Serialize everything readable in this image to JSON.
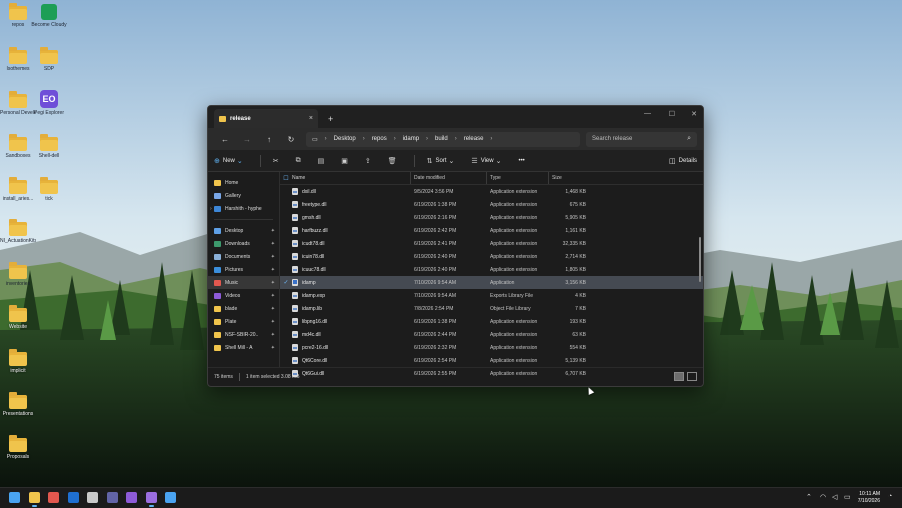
{
  "desktop": {
    "icons": [
      {
        "label": "repos"
      },
      {
        "label": "Become Cloudy"
      },
      {
        "label": "Isothemes"
      },
      {
        "label": "SDP"
      },
      {
        "label": "Personal Development..."
      },
      {
        "label": "Pegi Explorer"
      },
      {
        "label": "Sandboxes"
      },
      {
        "label": "Shell-dell"
      },
      {
        "label": "install_aries..."
      },
      {
        "label": "tick"
      },
      {
        "label": "NI_ActuationKits"
      },
      {
        "label": "inventories"
      },
      {
        "label": "Website"
      },
      {
        "label": "implicit"
      },
      {
        "label": "Presentations"
      },
      {
        "label": "Proposals"
      }
    ]
  },
  "window": {
    "tab_title": "release",
    "tab_close": "×",
    "new_tab": "+",
    "minimize": "—",
    "maximize": "☐",
    "close": "✕",
    "breadcrumb": [
      "Desktop",
      "repos",
      "idamp",
      "build",
      "release"
    ],
    "search_placeholder": "Search release",
    "toolbar": {
      "new": "New",
      "sort": "Sort",
      "view": "View",
      "more": "•••",
      "details": "Details"
    },
    "sidebar": [
      {
        "label": "Home",
        "color": "#f0c44c",
        "pinned": false
      },
      {
        "label": "Gallery",
        "color": "#7aa7e8",
        "pinned": false
      },
      {
        "label": "Harshith - hyphe",
        "color": "#3d86d6",
        "pinned": false
      },
      {
        "label": "Desktop",
        "color": "#5fa0e6",
        "pinned": true
      },
      {
        "label": "Downloads",
        "color": "#3d9a6d",
        "pinned": true
      },
      {
        "label": "Documents",
        "color": "#8ab0d8",
        "pinned": true
      },
      {
        "label": "Pictures",
        "color": "#3b8fdc",
        "pinned": true
      },
      {
        "label": "Music",
        "color": "#e2584f",
        "pinned": true
      },
      {
        "label": "Videos",
        "color": "#8e5bd8",
        "pinned": true
      },
      {
        "label": "blade",
        "color": "#f0c44c",
        "pinned": true
      },
      {
        "label": "Plate",
        "color": "#f0c44c",
        "pinned": true
      },
      {
        "label": "NSF-SBIR-20..",
        "color": "#f0c44c",
        "pinned": true
      },
      {
        "label": "Shell Mill - A",
        "color": "#f0c44c",
        "pinned": true
      }
    ],
    "columns": {
      "name": "Name",
      "date": "Date modified",
      "type": "Type",
      "size": "Size"
    },
    "files": [
      {
        "name": "dxil.dll",
        "date": "9/5/2024 3:56 PM",
        "type": "Application extension",
        "size": "1,468 KB",
        "selected": false,
        "app": false
      },
      {
        "name": "freetype.dll",
        "date": "6/19/2026 1:38 PM",
        "type": "Application extension",
        "size": "675 KB",
        "selected": false,
        "app": false
      },
      {
        "name": "gmsh.dll",
        "date": "6/19/2026 2:16 PM",
        "type": "Application extension",
        "size": "5,905 KB",
        "selected": false,
        "app": false
      },
      {
        "name": "harfbuzz.dll",
        "date": "6/19/2026 2:42 PM",
        "type": "Application extension",
        "size": "1,161 KB",
        "selected": false,
        "app": false
      },
      {
        "name": "icudt78.dll",
        "date": "6/19/2026 2:41 PM",
        "type": "Application extension",
        "size": "32,335 KB",
        "selected": false,
        "app": false
      },
      {
        "name": "icuin78.dll",
        "date": "6/19/2026 2:40 PM",
        "type": "Application extension",
        "size": "2,714 KB",
        "selected": false,
        "app": false
      },
      {
        "name": "icuuc78.dll",
        "date": "6/19/2026 2:40 PM",
        "type": "Application extension",
        "size": "1,805 KB",
        "selected": false,
        "app": false
      },
      {
        "name": "idamp",
        "date": "7/10/2026 9:54 AM",
        "type": "Application",
        "size": "3,156 KB",
        "selected": true,
        "app": true
      },
      {
        "name": "idamp.exp",
        "date": "7/10/2026 9:54 AM",
        "type": "Exports Library File",
        "size": "4 KB",
        "selected": false,
        "app": false
      },
      {
        "name": "idamp.lib",
        "date": "7/8/2026 2:54 PM",
        "type": "Object File Library",
        "size": "7 KB",
        "selected": false,
        "app": false
      },
      {
        "name": "libpng16.dll",
        "date": "6/19/2026 1:38 PM",
        "type": "Application extension",
        "size": "193 KB",
        "selected": false,
        "app": false
      },
      {
        "name": "md4c.dll",
        "date": "6/19/2026 2:44 PM",
        "type": "Application extension",
        "size": "63 KB",
        "selected": false,
        "app": false
      },
      {
        "name": "pcre2-16.dll",
        "date": "6/19/2026 2:32 PM",
        "type": "Application extension",
        "size": "554 KB",
        "selected": false,
        "app": false
      },
      {
        "name": "Qt6Core.dll",
        "date": "6/19/2026 2:54 PM",
        "type": "Application extension",
        "size": "5,139 KB",
        "selected": false,
        "app": false
      },
      {
        "name": "Qt6Gui.dll",
        "date": "6/19/2026 2:55 PM",
        "type": "Application extension",
        "size": "6,707 KB",
        "selected": false,
        "app": false
      }
    ],
    "status": {
      "count": "75 items",
      "selection": "1 item selected  3.08 MB"
    }
  },
  "taskbar": {
    "icons": [
      {
        "name": "start-icon",
        "color": "#4aa3f0"
      },
      {
        "name": "file-explorer-icon",
        "color": "#f0c44c"
      },
      {
        "name": "chrome-icon",
        "color": "#e2584f"
      },
      {
        "name": "outlook-icon",
        "color": "#1f6fd1"
      },
      {
        "name": "notepad-icon",
        "color": "#c9c9c9"
      },
      {
        "name": "teams-icon",
        "color": "#6264a7"
      },
      {
        "name": "visual-studio-icon",
        "color": "#8e5bd8"
      },
      {
        "name": "app-window-icon",
        "color": "#9b6ee0"
      },
      {
        "name": "terminal-icon",
        "color": "#4aa3f0"
      }
    ],
    "time": "10:11 AM",
    "date": "7/10/2026"
  }
}
